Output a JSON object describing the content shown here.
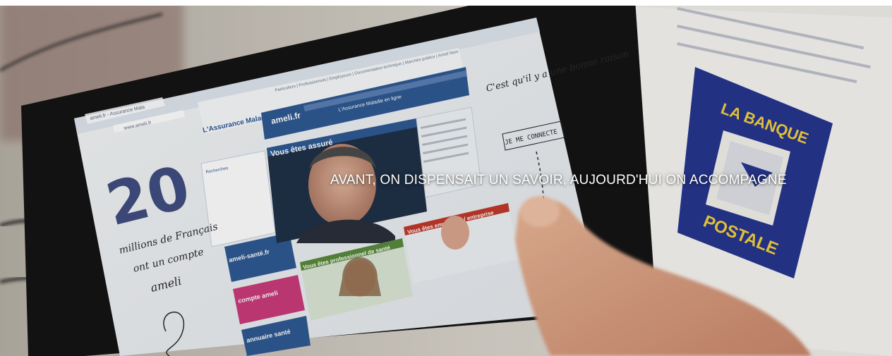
{
  "hero": {
    "headline": "AVANT, ON DISPENSAIT UN SAVOIR, AUJOURD'HUI ON ACCOMPAGNE"
  },
  "photo": {
    "browser_tab": "ameli.fr - Assurance Mala",
    "browser_url": "www.ameli.fr",
    "site_brand": "L'Assurance Maladie",
    "site_header_pill": "ameli.fr",
    "site_header_sub": "L'Assurance Maladie en ligne",
    "site_nav": "Particuliers | Professionnels | Employeurs | Documentation technique | Marchés publics | Ameli Nom",
    "feature_label": "Vous êtes assuré",
    "tile_sante_pro": "Vous êtes professionnel de santé",
    "tile_employeur": "Vous êtes employeur / entreprise",
    "menu_1": "ameli-santé.fr",
    "menu_2": "compte ameli",
    "menu_3": "annuaire santé",
    "sidebar_heading": "Recherches",
    "right_note": "C'est qu'il y a une bonne raison",
    "connect_button": "JE ME CONNECTE",
    "doodle_number": "20",
    "doodle_text_1": "millions de Français",
    "doodle_text_2": "ont un compte",
    "doodle_text_3": "ameli",
    "sign_line_1": "LA BANQUE",
    "sign_line_2": "POSTALE"
  },
  "colors": {
    "headline": "#ffffff",
    "site_blue": "#2f5a93",
    "site_pink": "#c93b7a",
    "sign_blue": "#27368f",
    "sign_yellow": "#f3d03e"
  }
}
